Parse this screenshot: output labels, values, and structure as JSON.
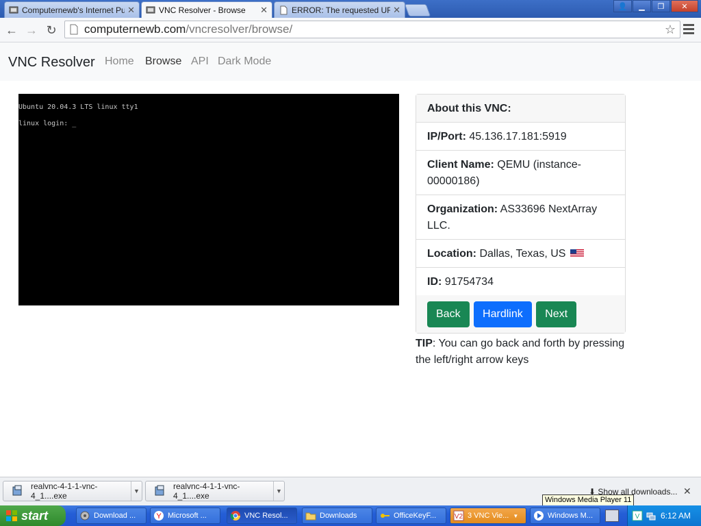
{
  "browser": {
    "tabs": [
      {
        "title": "Computernewb's Internet Pu",
        "active": false
      },
      {
        "title": "VNC Resolver - Browse",
        "active": true
      },
      {
        "title": "ERROR: The requested URL",
        "active": false
      }
    ],
    "url_host": "computernewb.com",
    "url_path": "/vncresolver/browse/"
  },
  "navbar": {
    "brand": "VNC Resolver",
    "links": [
      "Home",
      "Browse",
      "API",
      "Dark Mode"
    ],
    "active_link": "Browse"
  },
  "vnc": {
    "line1": "Ubuntu 20.04.3 LTS linux tty1",
    "line2": "linux login: _"
  },
  "info": {
    "header": "About this VNC:",
    "ip_label": "IP/Port:",
    "ip_value": "45.136.17.181:5919",
    "client_label": "Client Name:",
    "client_value": "QEMU (instance-00000186)",
    "org_label": "Organization:",
    "org_value": "AS33696 NextArray LLC.",
    "location_label": "Location:",
    "location_value": "Dallas, Texas, US",
    "id_label": "ID:",
    "id_value": "91754734"
  },
  "buttons": {
    "back": "Back",
    "hardlink": "Hardlink",
    "next": "Next"
  },
  "tip": {
    "label": "TIP",
    "text": ": You can go back and forth by pressing the left/right arrow keys"
  },
  "downloads": {
    "items": [
      "realvnc-4-1-1-vnc-4_1....exe",
      "realvnc-4-1-1-vnc-4_1....exe"
    ],
    "show_all": "Show all downloads...",
    "tooltip": "Windows Media Player 11"
  },
  "taskbar": {
    "start": "start",
    "items": [
      "Download ...",
      "Microsoft ...",
      "VNC Resol...",
      "Downloads",
      "OfficeKeyF...",
      "3 VNC Vie...",
      "Windows M..."
    ],
    "clock": "6:12 AM"
  },
  "colors": {
    "success": "#198754",
    "primary": "#0d6efd"
  }
}
